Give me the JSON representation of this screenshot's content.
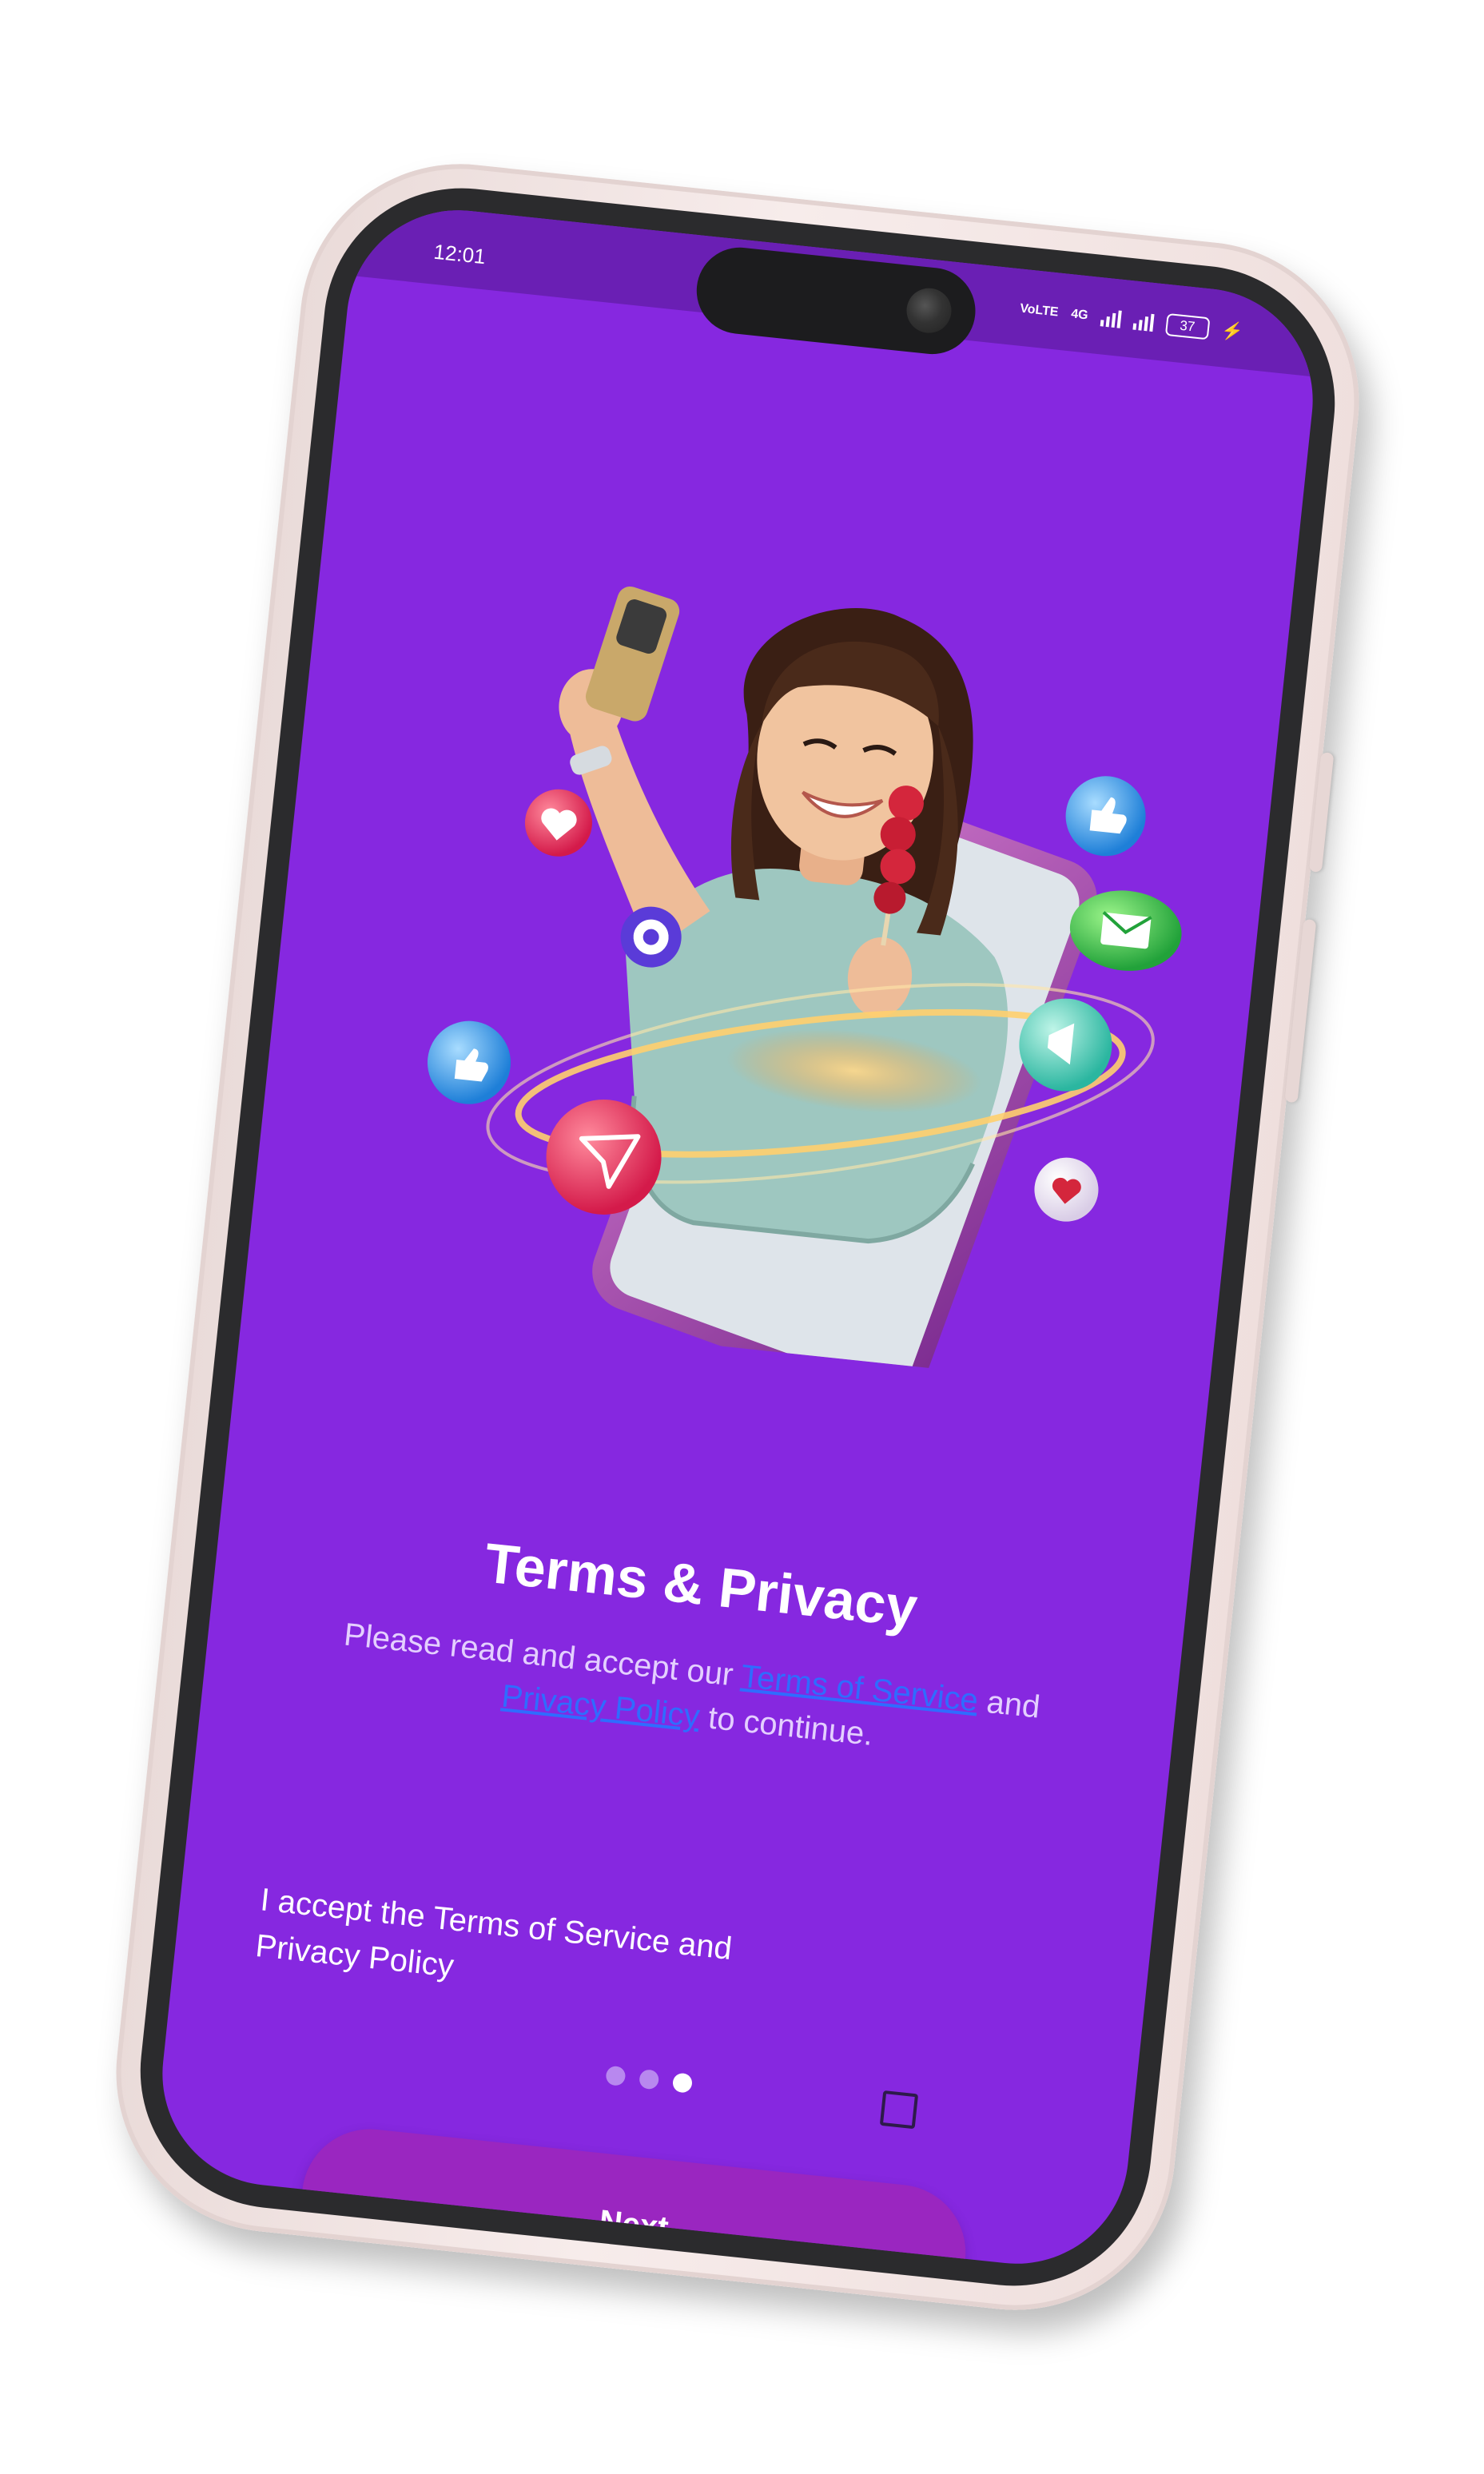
{
  "status_bar": {
    "time": "12:01",
    "network_label": "VoLTE",
    "network_type": "4G",
    "battery_level": "37",
    "charging": true
  },
  "onboarding": {
    "title": "Terms & Privacy",
    "description_prefix": "Please read and accept our ",
    "terms_link": "Terms of Service",
    "description_and": " and ",
    "privacy_link": "Privacy Policy",
    "description_suffix": " to continue.",
    "consent_label": "I accept the Terms of Service and Privacy Policy",
    "consent_checked": false,
    "page_indicator": {
      "total": 3,
      "current": 3
    },
    "next_button": "Next"
  },
  "colors": {
    "screen_background": "#8628e0",
    "status_bar": "#6a1fb4",
    "next_button": "#9a26c0",
    "link": "#2f6cff",
    "frame": "#efdfdd"
  },
  "illustration": {
    "icons": [
      "heart-bubble-icon",
      "thumbs-up-bubble-icon",
      "mail-bubble-icon",
      "compass-bubble-icon",
      "megaphone-bubble-icon",
      "like-bubble-icon",
      "paper-plane-bubble-icon"
    ]
  }
}
